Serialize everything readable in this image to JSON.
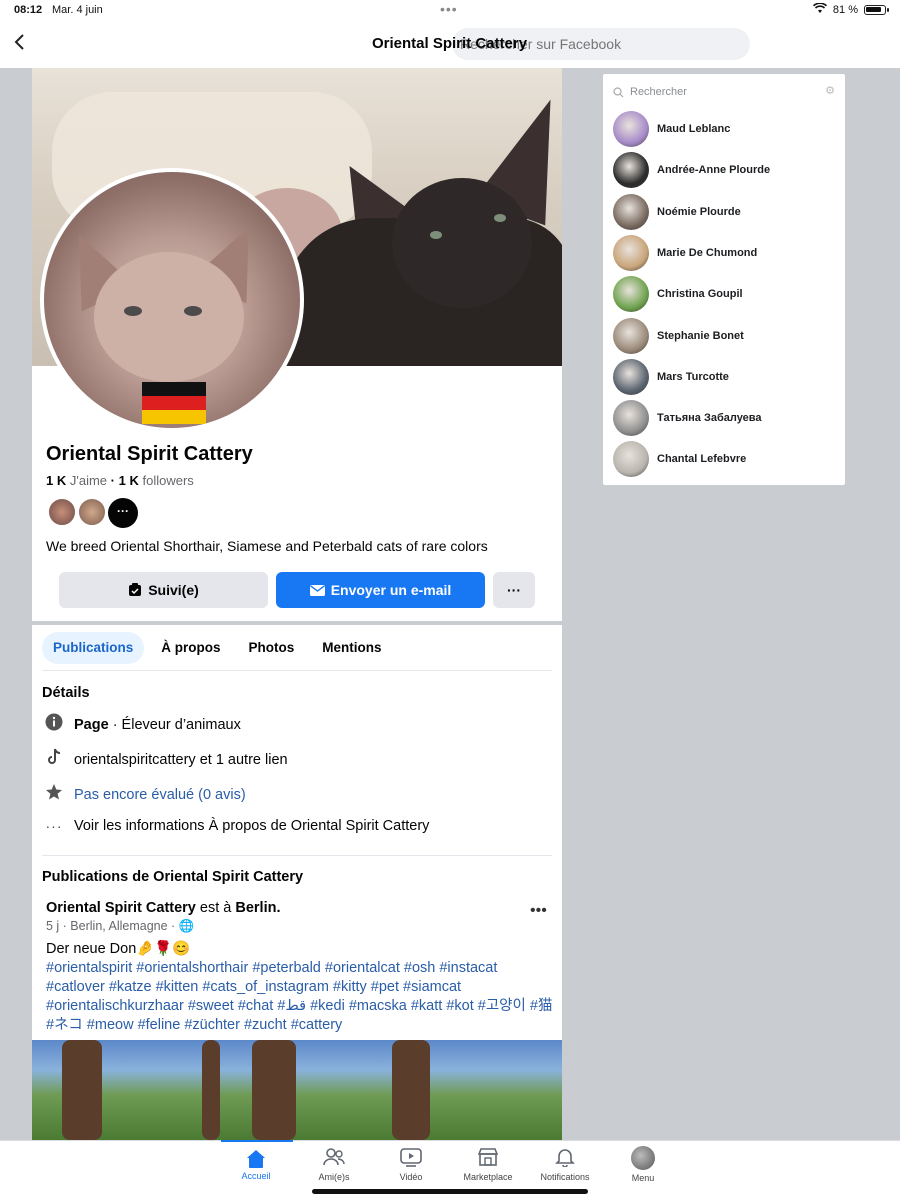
{
  "status_bar": {
    "time": "08:12",
    "date": "Mar. 4 juin",
    "battery": "81 %"
  },
  "header": {
    "title": "Oriental Spirit Cattery",
    "search_placeholder": "Rechercher sur Facebook"
  },
  "profile": {
    "name": "Oriental Spirit Cattery",
    "likes_count": "1 K",
    "likes_label": "J'aime",
    "separator": "·",
    "followers_count": "1 K",
    "followers_label": "followers",
    "more_friends": "···",
    "bio": "We breed Oriental Shorthair, Siamese and Peterbald cats of rare colors"
  },
  "actions": {
    "follow": "Suivi(e)",
    "email": "Envoyer un e-mail",
    "more": "···"
  },
  "tabs": [
    "Publications",
    "À propos",
    "Photos",
    "Mentions"
  ],
  "details": {
    "title": "Détails",
    "page_label": "Page",
    "page_category": " · Éleveur d’animaux",
    "link": "orientalspiritcattery et 1 autre lien",
    "rating": "Pas encore évalué (0 avis)",
    "about": "Voir les informations À propos de Oriental Spirit Cattery"
  },
  "posts": {
    "title": "Publications de Oriental Spirit Cattery",
    "post": {
      "author": "Oriental Spirit Cattery",
      "middle": " est à ",
      "place": "Berlin.",
      "meta": "5 j · Berlin, Allemagne · 🌐",
      "text": "Der neue Don🤌🌹😊",
      "tags": "#orientalspirit #orientalshorthair #peterbald #orientalcat #osh #instacat #catlover #katze #kitten #cats_of_instagram #kitty #pet #siamcat #orientalischkurzhaar #sweet #chat #قط #kedi #macska #katt #kot #고양이 #猫 #ネコ  #meow #feline #züchter #zucht #cattery"
    }
  },
  "contacts": {
    "search_placeholder": "Rechercher",
    "list": [
      {
        "name": "Maud Leblanc",
        "color": "#a78bc9"
      },
      {
        "name": "Andrée-Anne Plourde",
        "color": "#2b2b2b"
      },
      {
        "name": "Noémie Plourde",
        "color": "#7a6a60"
      },
      {
        "name": "Marie De Chumond",
        "color": "#c9a57a"
      },
      {
        "name": "Christina Goupil",
        "color": "#6fa34e"
      },
      {
        "name": "Stephanie Bonet",
        "color": "#9a8a7a"
      },
      {
        "name": "Mars Turcotte",
        "color": "#5b6470"
      },
      {
        "name": "Татьяна Забалуева",
        "color": "#8f8f8f"
      },
      {
        "name": "Chantal Lefebvre",
        "color": "#b9b4ae"
      }
    ]
  },
  "bottom_nav": [
    {
      "label": "Accueil",
      "icon": "home-icon"
    },
    {
      "label": "Ami(e)s",
      "icon": "friends-icon"
    },
    {
      "label": "Vidéo",
      "icon": "video-icon"
    },
    {
      "label": "Marketplace",
      "icon": "marketplace-icon"
    },
    {
      "label": "Notifications",
      "icon": "bell-icon"
    },
    {
      "label": "Menu",
      "icon": "menu-avatar"
    }
  ],
  "colors": {
    "accent": "#1877f2",
    "link": "#2a5da8",
    "backdrop": "#c9ccd1"
  }
}
